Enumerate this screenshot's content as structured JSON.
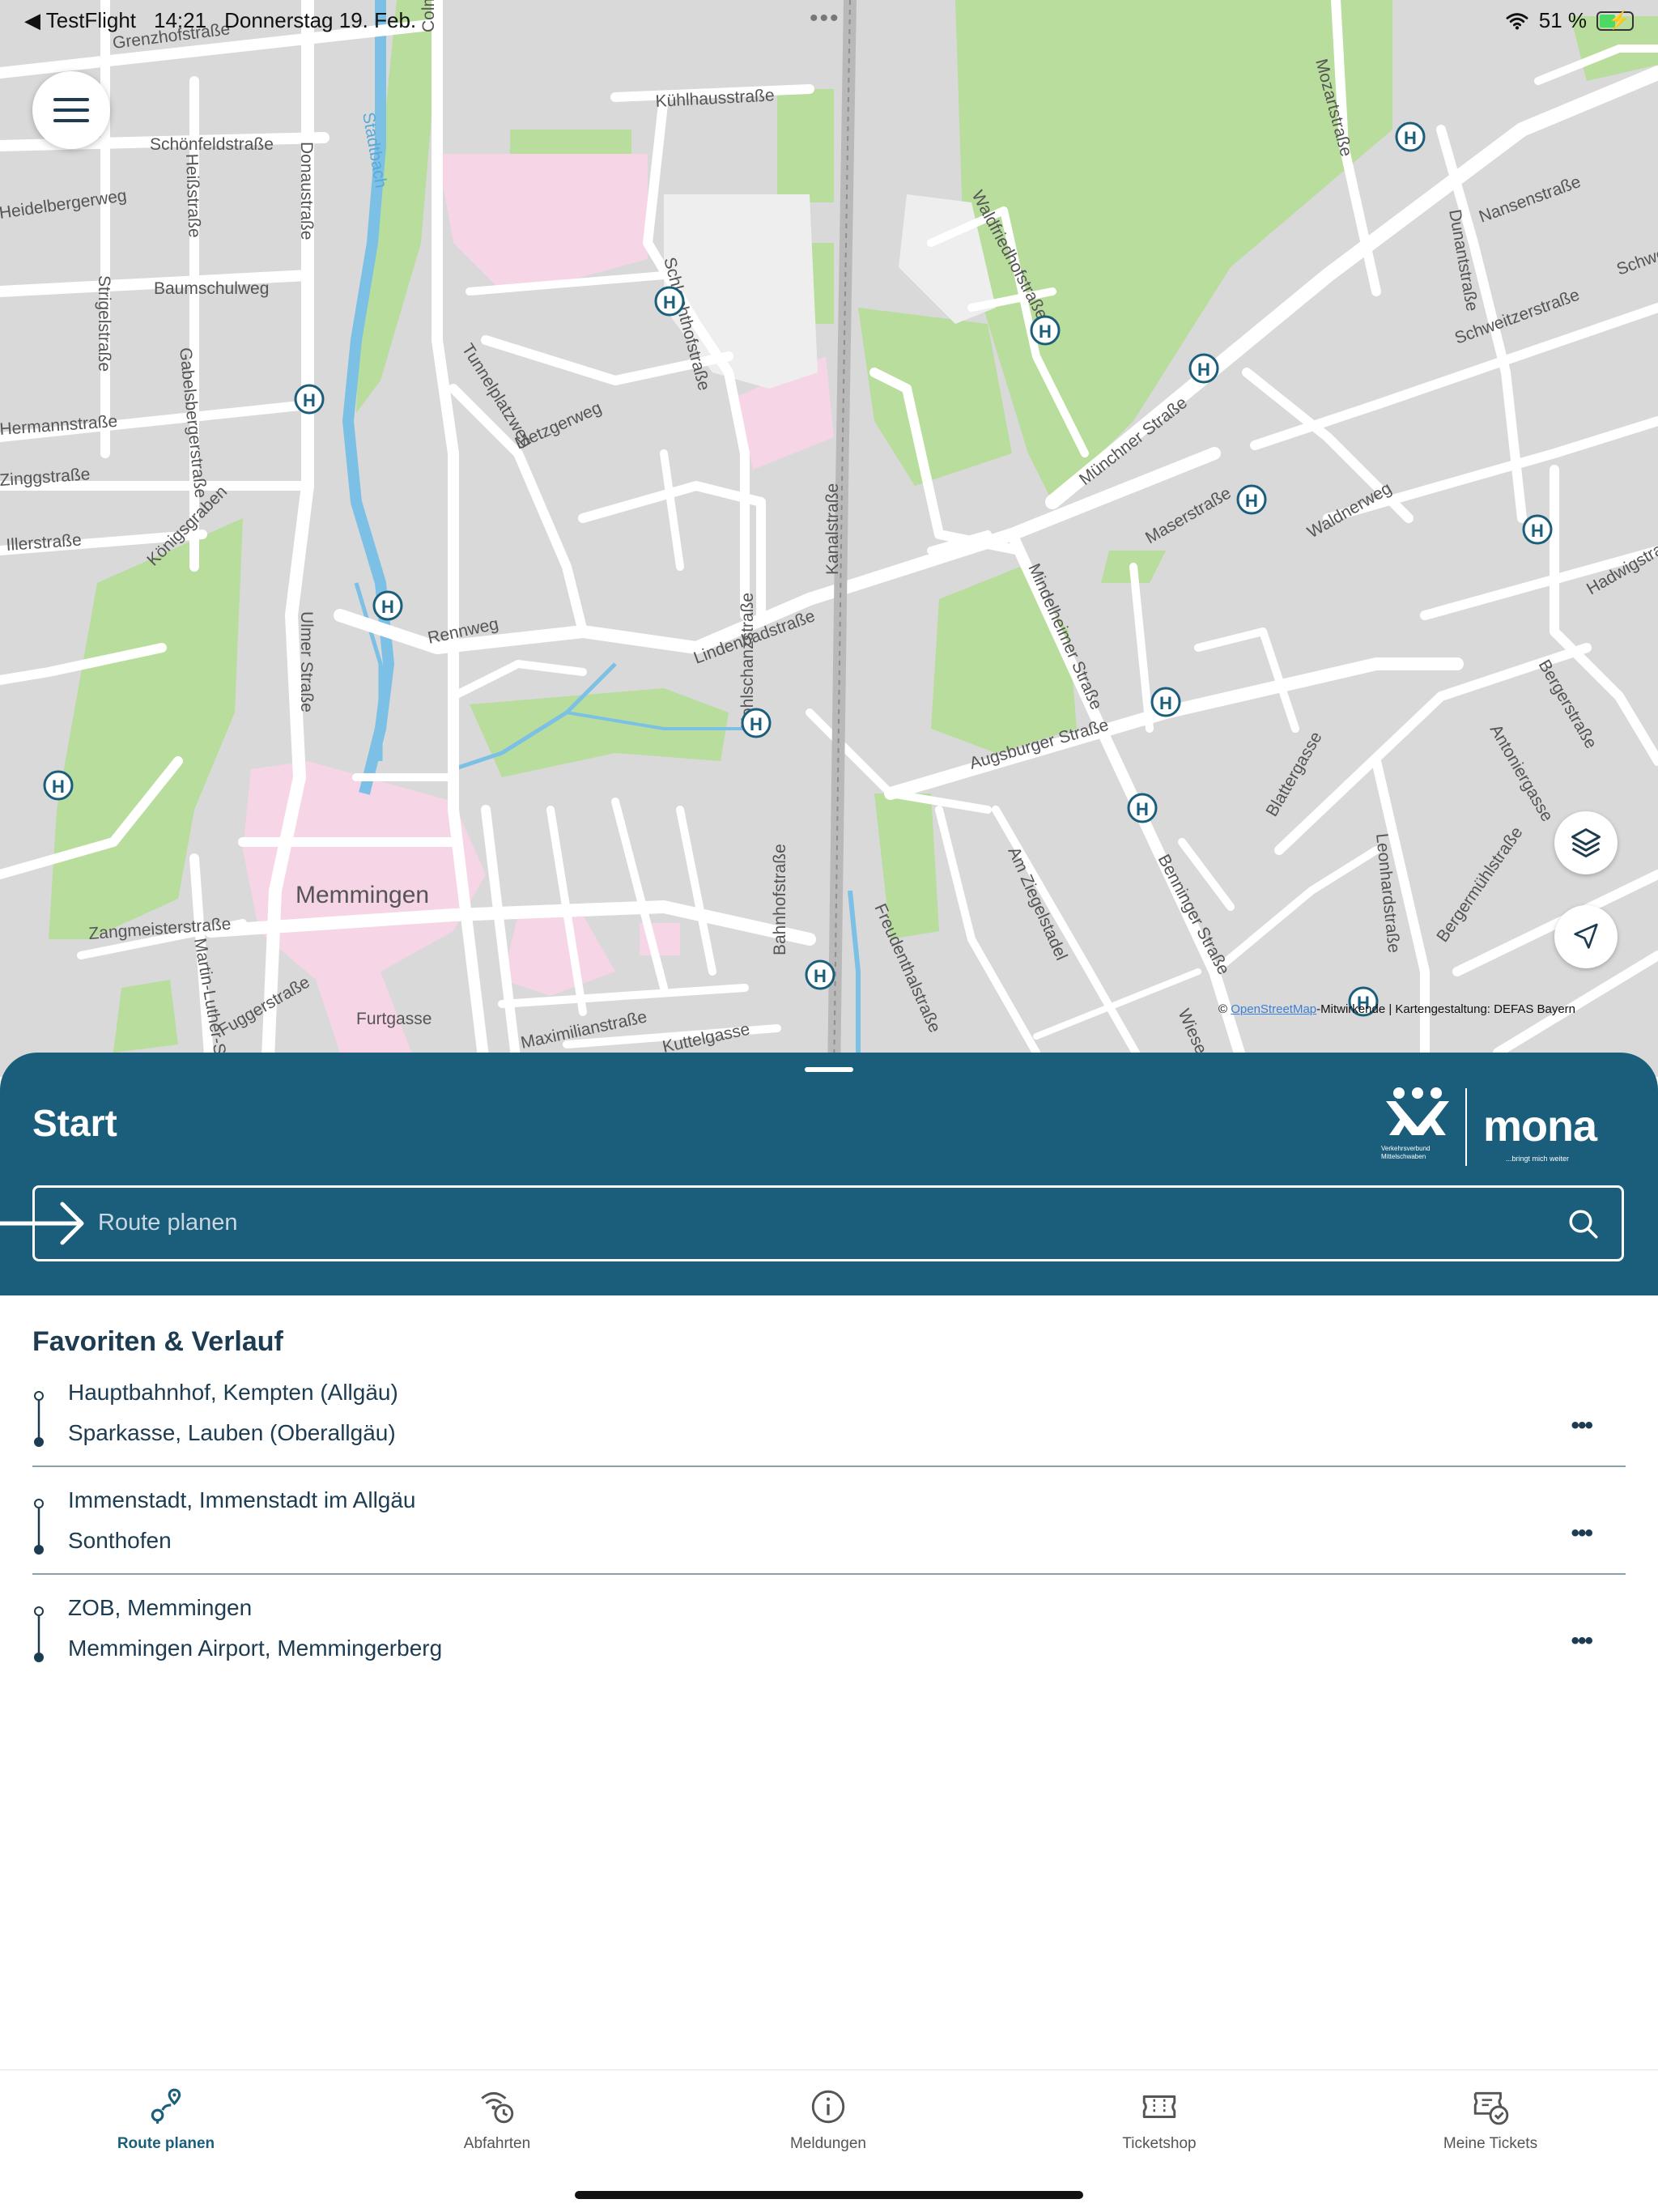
{
  "status_bar": {
    "back_app": "◀ TestFlight",
    "time": "14:21",
    "date": "Donnerstag 19. Feb.",
    "battery": "51 %",
    "battery_level": 0.51
  },
  "map": {
    "city_label": "Memmingen",
    "attribution_prefix": "© ",
    "attribution_link": "OpenStreetMap",
    "attribution_suffix": "-Mitwirkende | Kartengestaltung: DEFAS Bayern",
    "street_labels": [
      "Grenzhofstraße",
      "Schönfeldstraße",
      "Baumschulweg",
      "Stadtbach",
      "Colmarer Straße",
      "Kühlhausstraße",
      "Schlachthofstraße",
      "Tunnelplatzweg",
      "Metzgerweg",
      "Kanalstraße",
      "Lindenbadstraße",
      "Waldfriedhofstraße",
      "Münchner Straße",
      "Mozartstraße",
      "Nansenstraße",
      "Dunantstraße",
      "Schweitzerstraße",
      "Maserstraße",
      "Waldnerweg",
      "Augsburger Straße",
      "Rennweg",
      "Mindelheimer Straße",
      "Bahnhofstraße",
      "Memmingen",
      "Zangmeisterstraße",
      "Maximilianstraße",
      "Kuttelgasse",
      "Furtgasse",
      "Fuggerstraße",
      "Martin-Luther-Straße",
      "Benninger Straße",
      "Am Ziegelstadel",
      "Freudenthalstraße",
      "Blattergasse",
      "Leonhardstraße",
      "Bergermühlstraße",
      "Antoniergasse",
      "Bergerstraße",
      "Hadwigstraße",
      "Königsgraben",
      "Donaustraße",
      "Ulmer Straße",
      "Strigelstraße",
      "Gabelsbergerstraße",
      "Heißstraße",
      "Illerstraße",
      "Zinggstraße",
      "Hermannstraße",
      "Heidelbergerweg",
      "Kohlschanzstraße",
      "Wiesenstraße",
      "Schweizerstraße"
    ]
  },
  "sheet": {
    "title": "Start",
    "logo_brand": "mona",
    "logo_tagline": "...bringt mich weiter",
    "logo_vvm": "Verkehrsverbund Mittelschwaben",
    "search_placeholder": "Route planen"
  },
  "favorites": {
    "title": "Favoriten & Verlauf",
    "items": [
      {
        "from": "Hauptbahnhof, Kempten (Allgäu)",
        "to": "Sparkasse, Lauben (Oberallgäu)",
        "more": "•••"
      },
      {
        "from": "Immenstadt, Immenstadt im Allgäu",
        "to": "Sonthofen",
        "more": "•••"
      },
      {
        "from": "ZOB, Memmingen",
        "to": "Memmingen Airport, Memmingerberg",
        "more": "•••"
      }
    ]
  },
  "tabs": [
    {
      "label": "Route planen",
      "icon": "route-pin-icon",
      "active": true
    },
    {
      "label": "Abfahrten",
      "icon": "departures-icon",
      "active": false
    },
    {
      "label": "Meldungen",
      "icon": "info-icon",
      "active": false
    },
    {
      "label": "Ticketshop",
      "icon": "ticket-icon",
      "active": false
    },
    {
      "label": "Meine Tickets",
      "icon": "my-tickets-icon",
      "active": false
    }
  ],
  "colors": {
    "primary": "#1b5e7c",
    "text_dark": "#1d3c52",
    "map_background": "#d9d9d9",
    "map_green": "#b8dd9c",
    "map_pink": "#f5d5e6",
    "water": "#7cc0e6"
  }
}
